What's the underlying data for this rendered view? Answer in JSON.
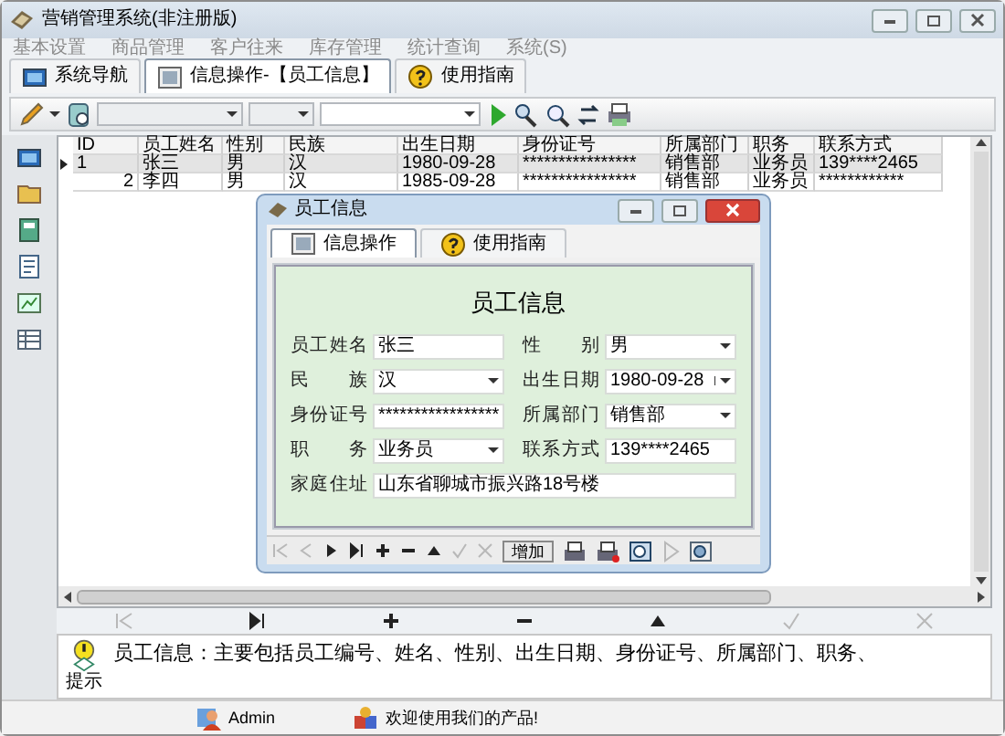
{
  "window": {
    "title": "营销管理系统(非注册版)"
  },
  "menu": [
    "基本设置",
    "商品管理",
    "客户往来",
    "库存管理",
    "统计查询",
    "系统(S)"
  ],
  "tabs": [
    {
      "label": "系统导航",
      "selected": false,
      "kind": "nav"
    },
    {
      "label": "信息操作-【员工信息】",
      "selected": true,
      "kind": "form"
    },
    {
      "label": "使用指南",
      "selected": false,
      "kind": "help"
    }
  ],
  "grid": {
    "columns": [
      "ID",
      "员工姓名",
      "性别",
      "民族",
      "出生日期",
      "身份证号",
      "所属部门",
      "职务",
      "联系方式"
    ],
    "rows": [
      {
        "selected": true,
        "cells": [
          "1",
          "张三",
          "男",
          "汉",
          "1980-09-28",
          "****************",
          "销售部",
          "业务员",
          "139****2465"
        ]
      },
      {
        "selected": false,
        "cells": [
          "2",
          "李四",
          "男",
          "汉",
          "1985-09-28",
          "****************",
          "销售部",
          "业务员",
          "************"
        ]
      }
    ]
  },
  "dialog": {
    "title": "员工信息",
    "tabs": [
      {
        "label": "信息操作",
        "selected": true,
        "kind": "form"
      },
      {
        "label": "使用指南",
        "selected": false,
        "kind": "help"
      }
    ],
    "heading": "员工信息",
    "fields": [
      {
        "label": "员工姓名",
        "value": "张三",
        "kind": "text"
      },
      {
        "label": "性 别",
        "value": "男",
        "kind": "select"
      },
      {
        "label": "民 族",
        "value": "汉",
        "kind": "select"
      },
      {
        "label": "出生日期",
        "value": "1980-09-28",
        "kind": "date"
      },
      {
        "label": "身份证号",
        "value": "*****************",
        "kind": "text"
      },
      {
        "label": "所属部门",
        "value": "销售部",
        "kind": "select"
      },
      {
        "label": "职 务",
        "value": "业务员",
        "kind": "select"
      },
      {
        "label": "联系方式",
        "value": "139****2465",
        "kind": "text"
      },
      {
        "label": "家庭住址",
        "value": "山东省聊城市振兴路18号楼",
        "kind": "wide"
      }
    ],
    "button": "增加"
  },
  "hint": {
    "label": "提示",
    "text": "员工信息：主要包括员工编号、姓名、性别、出生日期、身份证号、所属部门、职务、"
  },
  "status_bar": [
    {
      "text": "Admin",
      "kind": "user"
    },
    {
      "text": "欢迎使用我们的产品!",
      "kind": "welcome"
    }
  ]
}
